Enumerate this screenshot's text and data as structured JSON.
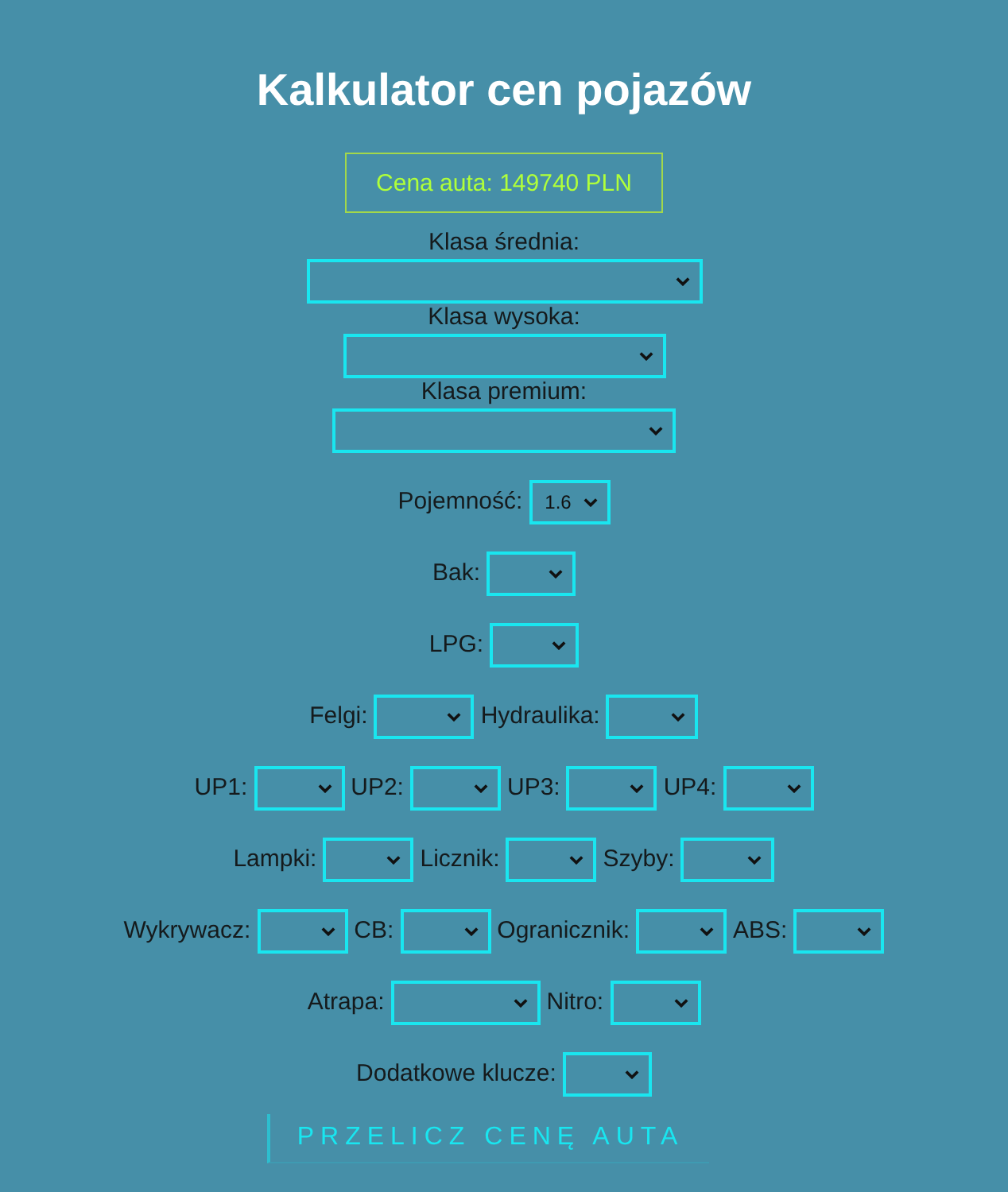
{
  "title": "Kalkulator cen pojazów",
  "price": "Cena auta: 149740 PLN",
  "class_fields": [
    {
      "label": "Klasa średnia:"
    },
    {
      "label": "Klasa wysoka:"
    },
    {
      "label": "Klasa premium:"
    }
  ],
  "rows": [
    {
      "fields": [
        {
          "label": "Pojemność:",
          "value": "1.6"
        }
      ]
    },
    {
      "fields": [
        {
          "label": "Bak:"
        }
      ]
    },
    {
      "fields": [
        {
          "label": "LPG:"
        }
      ]
    },
    {
      "fields": [
        {
          "label": "Felgi:"
        },
        {
          "label": "Hydraulika:"
        }
      ]
    },
    {
      "fields": [
        {
          "label": "UP1:"
        },
        {
          "label": "UP2:"
        },
        {
          "label": "UP3:"
        },
        {
          "label": "UP4:"
        }
      ]
    },
    {
      "fields": [
        {
          "label": "Lampki:"
        },
        {
          "label": "Licznik:"
        },
        {
          "label": "Szyby:"
        }
      ]
    },
    {
      "fields": [
        {
          "label": "Wykrywacz:"
        },
        {
          "label": "CB:"
        },
        {
          "label": "Ogranicznik:"
        },
        {
          "label": "ABS:"
        }
      ]
    },
    {
      "fields": [
        {
          "label": "Atrapa:"
        },
        {
          "label": "Nitro:"
        }
      ]
    },
    {
      "fields": [
        {
          "label": "Dodatkowe klucze:"
        }
      ]
    }
  ],
  "button": "PRZELICZ CENĘ AUTA"
}
